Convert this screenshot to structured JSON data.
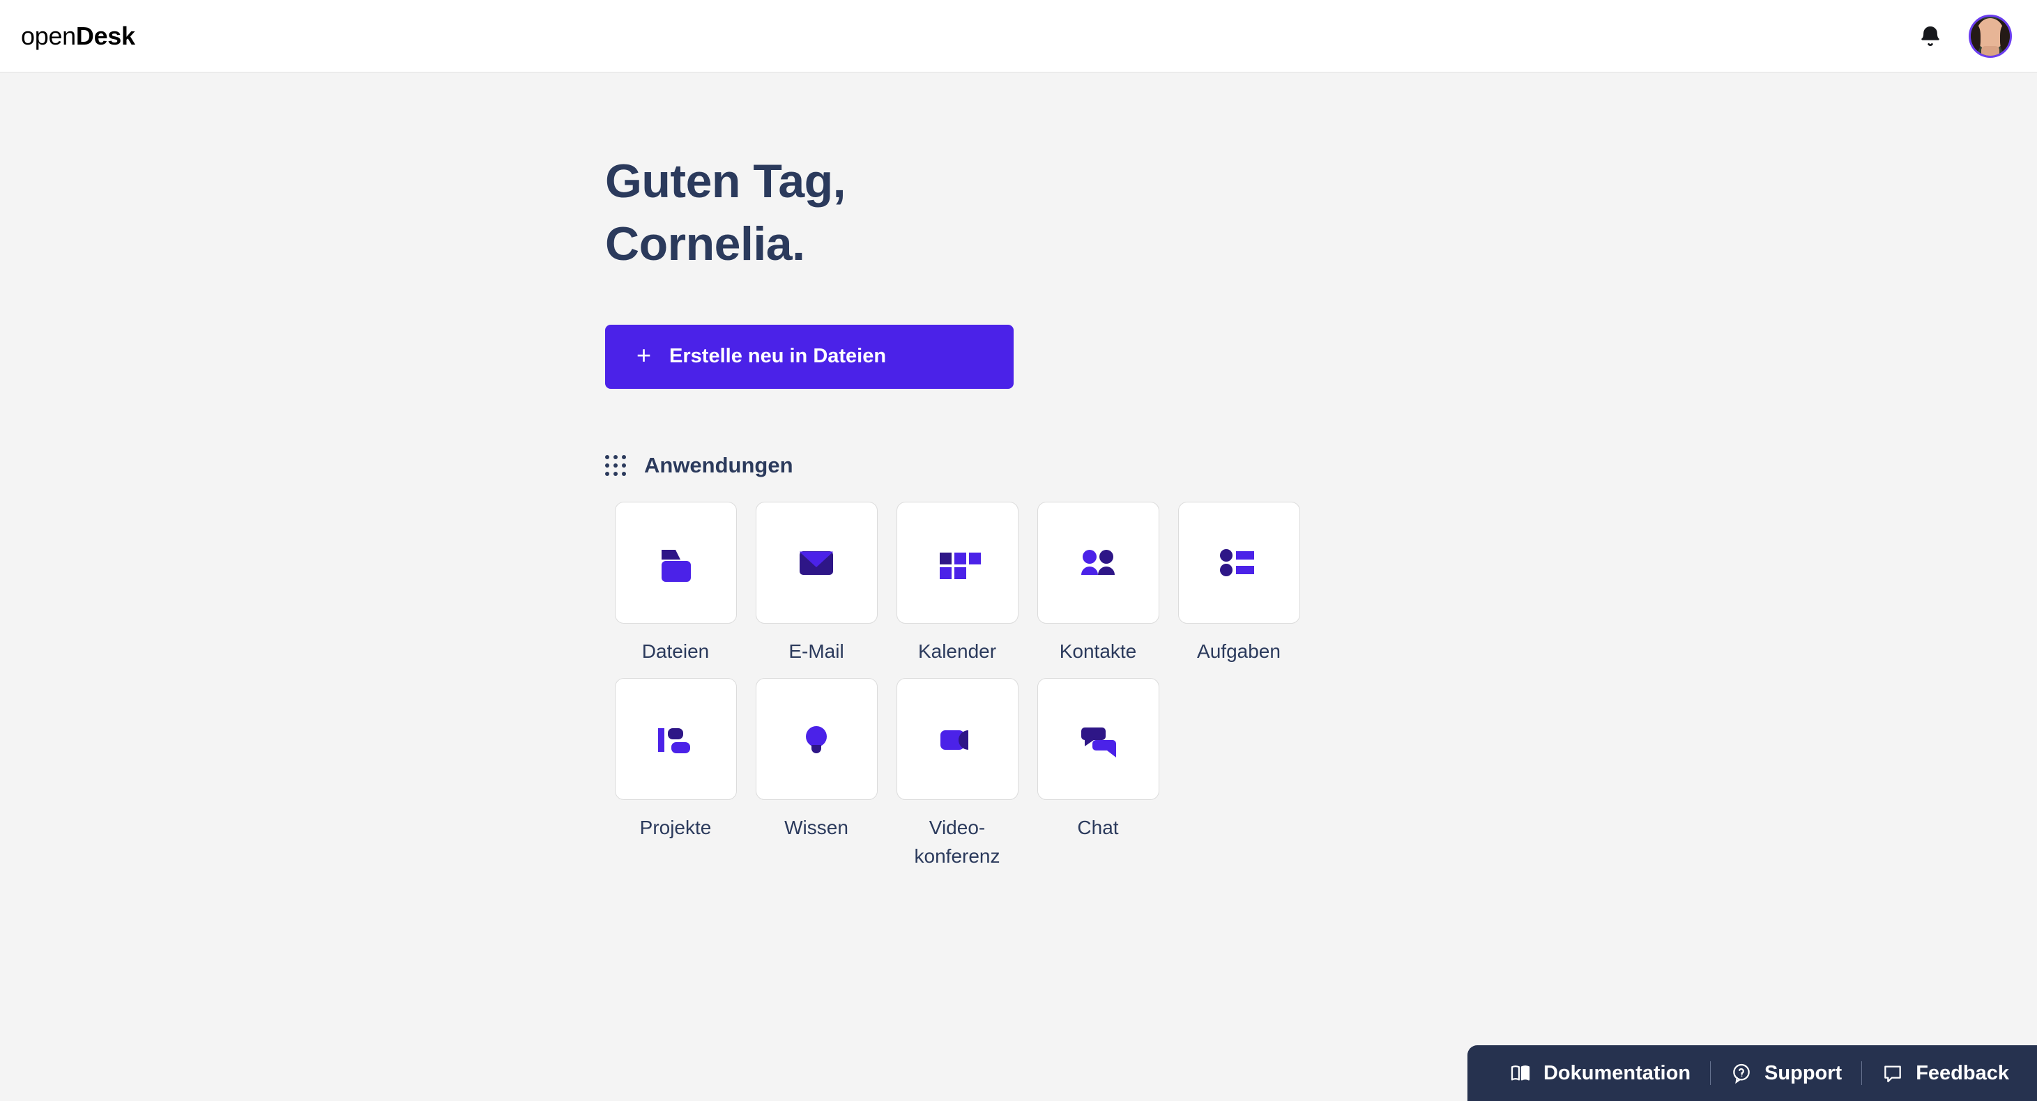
{
  "header": {
    "logo_open": "open",
    "logo_desk": "Desk",
    "notification_icon": "bell-icon",
    "avatar_alt": "user-avatar"
  },
  "main": {
    "greeting_line1": "Guten Tag,",
    "greeting_line2": "Cornelia.",
    "create_button": {
      "icon": "plus-icon",
      "label": "Erstelle neu in Dateien"
    },
    "applications_section": {
      "icon": "grid-dots-icon",
      "title": "Anwendungen",
      "apps": [
        {
          "label": "Dateien",
          "icon": "folder-icon"
        },
        {
          "label": "E-Mail",
          "icon": "envelope-icon"
        },
        {
          "label": "Kalender",
          "icon": "calendar-tiles-icon"
        },
        {
          "label": "Kontakte",
          "icon": "people-icon"
        },
        {
          "label": "Aufgaben",
          "icon": "task-list-icon"
        },
        {
          "label": "Projekte",
          "icon": "gantt-icon"
        },
        {
          "label": "Wissen",
          "icon": "lightbulb-icon"
        },
        {
          "label": "Video-\nkonferenz",
          "icon": "video-camera-icon"
        },
        {
          "label": "Chat",
          "icon": "chat-bubbles-icon"
        }
      ]
    }
  },
  "footer": {
    "links": [
      {
        "label": "Dokumentation",
        "icon": "book-icon"
      },
      {
        "label": "Support",
        "icon": "help-bubble-icon"
      },
      {
        "label": "Feedback",
        "icon": "feedback-bubble-icon"
      }
    ]
  },
  "colors": {
    "accent": "#4b22e8",
    "accent_dark": "#2e1687",
    "text_navy": "#2b3a5c",
    "footer_bg": "#26324f",
    "page_bg": "#f4f4f4"
  }
}
